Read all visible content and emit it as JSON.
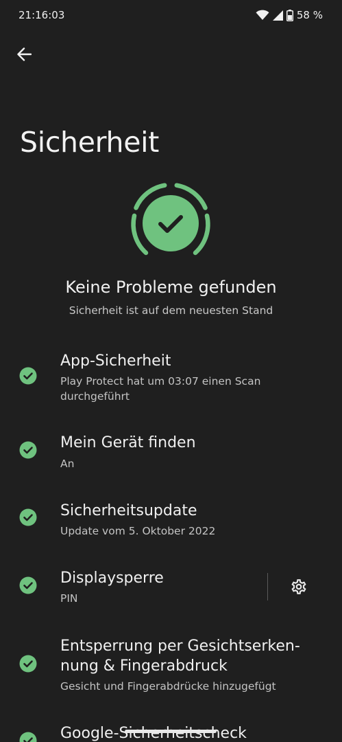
{
  "status_bar": {
    "time": "21:16:03",
    "battery_percent": "58 %",
    "icons": [
      "wifi-icon",
      "cellular-signal-icon",
      "battery-icon"
    ]
  },
  "header": {
    "back_icon": "arrow-back-icon",
    "title": "Sicherheit"
  },
  "summary": {
    "icon": "shield-check-icon",
    "title": "Keine Probleme gefunden",
    "subtitle": "Sicherheit ist auf dem neuesten Stand"
  },
  "items": [
    {
      "title": "App-Sicherheit",
      "subtitle": "Play Protect hat um 03:07 einen Scan durchgeführt",
      "status": "ok"
    },
    {
      "title": "Mein Gerät finden",
      "subtitle": "An",
      "status": "ok"
    },
    {
      "title": "Sicherheitsupdate",
      "subtitle": "Update vom 5. Oktober 2022",
      "status": "ok"
    },
    {
      "title": "Displaysperre",
      "subtitle": "PIN",
      "status": "ok",
      "action_icon": "gear-icon"
    },
    {
      "title": "Entsperrung per Gesichtserken­nung & Fingerabdruck",
      "subtitle": "Gesicht und Fingerabdrücke hinzugefügt",
      "status": "ok"
    },
    {
      "title": "Google-Sicherheitscheck",
      "subtitle": "",
      "status": "ok"
    }
  ],
  "colors": {
    "background": "#1f1f1f",
    "accent_green": "#6fc27f",
    "check_mark": "#1f1f1f",
    "text_primary": "#f0f0f0",
    "text_secondary": "#c4c4c4"
  }
}
